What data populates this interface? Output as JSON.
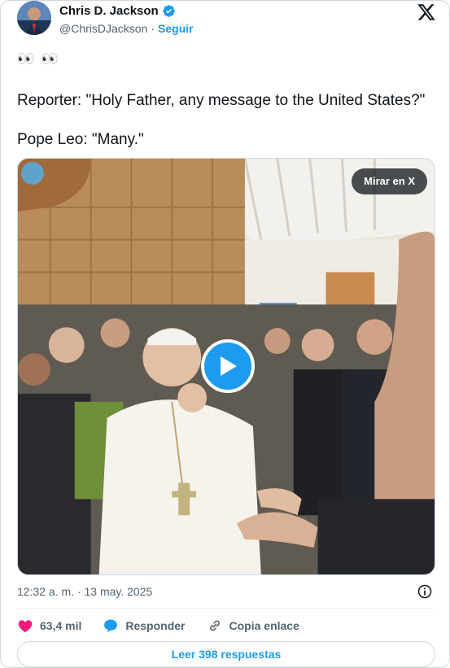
{
  "author": {
    "name": "Chris D. Jackson",
    "handle": "@ChrisDJackson",
    "separator": "·",
    "follow_label": "Seguir"
  },
  "tweet": {
    "emojis": "👀 👀",
    "paragraphs": [
      "Reporter: \"Holy Father, any message to the United States?\"",
      "Pope Leo: \"Many.\""
    ]
  },
  "media": {
    "watch_label": "Mirar en X"
  },
  "timestamp": "12:32 a. m. · 13 may. 2025",
  "actions": {
    "likes_count": "63,4 mil",
    "reply_label": "Responder",
    "copy_label": "Copia enlace"
  },
  "read_replies_label": "Leer 398 respuestas",
  "colors": {
    "accent": "#1d9bf0",
    "like": "#f91880",
    "muted": "#536471"
  }
}
